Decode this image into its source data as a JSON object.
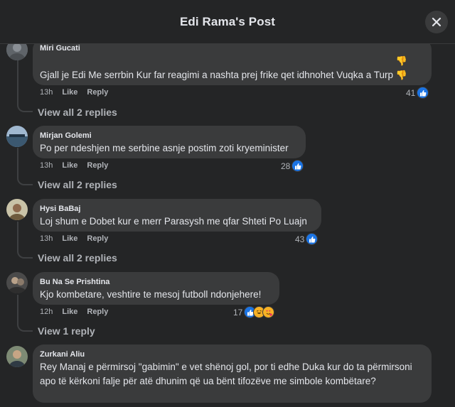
{
  "header": {
    "title": "Edi Rama's Post"
  },
  "comments": [
    {
      "author": "Miri Gucati",
      "text": "Gjall je Edi Me serrbin Kur far reagimi a nashta prej frike qet idhnohet Vuqka a Turp",
      "time": "13h",
      "like": "Like",
      "reply": "Reply",
      "count": "41",
      "view_replies": "View all 2 replies"
    },
    {
      "author": "Mirjan Golemi",
      "text": "Po per ndeshjen me serbine asnje postim zoti kryeminister",
      "time": "13h",
      "like": "Like",
      "reply": "Reply",
      "count": "28",
      "view_replies": "View all 2 replies"
    },
    {
      "author": "Hysi BaBaj",
      "text": "Loj shum e Dobet kur e merr Parasysh me qfar Shteti Po Luajn",
      "time": "13h",
      "like": "Like",
      "reply": "Reply",
      "count": "43",
      "view_replies": "View all 2 replies"
    },
    {
      "author": "Bu Na Se Prishtina",
      "text": "Kjo kombetare, veshtire te mesoj futboll ndonjehere!",
      "time": "12h",
      "like": "Like",
      "reply": "Reply",
      "count": "17",
      "view_replies": "View 1 reply"
    },
    {
      "author": "Zurkani Aliu",
      "text": "Rey Manaj e përmirsoj \"gabimin\" e vet shënoj gol, por ti edhe Duka kur do ta përmirsoni apo të kërkoni falje për atë dhunim që ua bënt tifozëve me simbole kombëtare?"
    }
  ],
  "icons": {
    "close": "close-icon",
    "like": "like-reaction-icon",
    "haha": "haha-reaction-icon",
    "love": "love-reaction-icon",
    "thumbs_down": "thumbs-down-emoji"
  },
  "colors": {
    "accent": "#1b74e4",
    "bubble": "#3a3b3c",
    "background": "#242526"
  }
}
